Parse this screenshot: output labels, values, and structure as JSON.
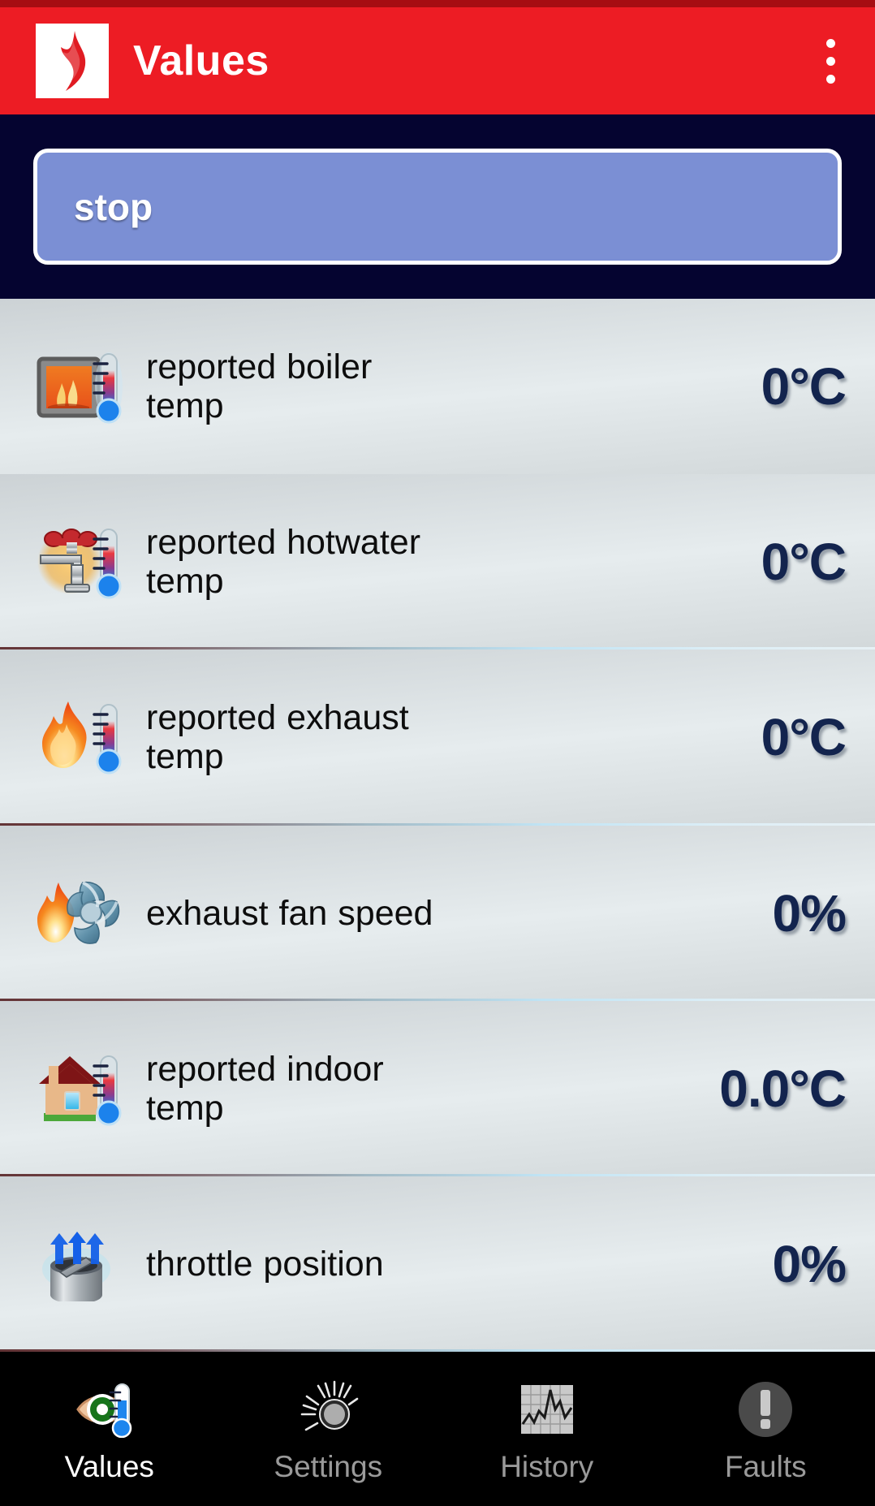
{
  "appbar": {
    "title": "Values",
    "logo_icon": "flame-logo-icon",
    "overflow_icon": "overflow-menu-icon",
    "background_color": "#ED1C24"
  },
  "status": {
    "button_label": "stop",
    "panel_background": "#050430",
    "button_color": "#7B8FD4",
    "button_border": "#FFFFFF"
  },
  "values": {
    "value_color": "#13244E",
    "rows": [
      {
        "icon": "boiler-furnace-thermometer-icon",
        "label_line1": "reported boiler",
        "label_line2": "temp",
        "value": "0°C"
      },
      {
        "icon": "hotwater-faucet-thermometer-icon",
        "label_line1": "reported hotwater",
        "label_line2": "temp",
        "value": "0°C"
      },
      {
        "icon": "exhaust-flame-thermometer-icon",
        "label_line1": "reported exhaust",
        "label_line2": "temp",
        "value": "0°C"
      },
      {
        "icon": "exhaust-fan-flame-icon",
        "label_line1": "exhaust fan speed",
        "label_line2": "",
        "value": "0%"
      },
      {
        "icon": "house-thermometer-icon",
        "label_line1": "reported indoor",
        "label_line2": "temp",
        "value": "0.0°C"
      },
      {
        "icon": "throttle-damper-icon",
        "label_line1": "throttle position",
        "label_line2": "",
        "value": "0%"
      }
    ]
  },
  "bottom_nav": {
    "tabs": [
      {
        "label": "Values",
        "icon": "eye-thermometer-icon",
        "active": true
      },
      {
        "label": "Settings",
        "icon": "knob-dial-icon",
        "active": false
      },
      {
        "label": "History",
        "icon": "chart-graph-icon",
        "active": false
      },
      {
        "label": "Faults",
        "icon": "exclamation-circle-icon",
        "active": false
      }
    ]
  }
}
